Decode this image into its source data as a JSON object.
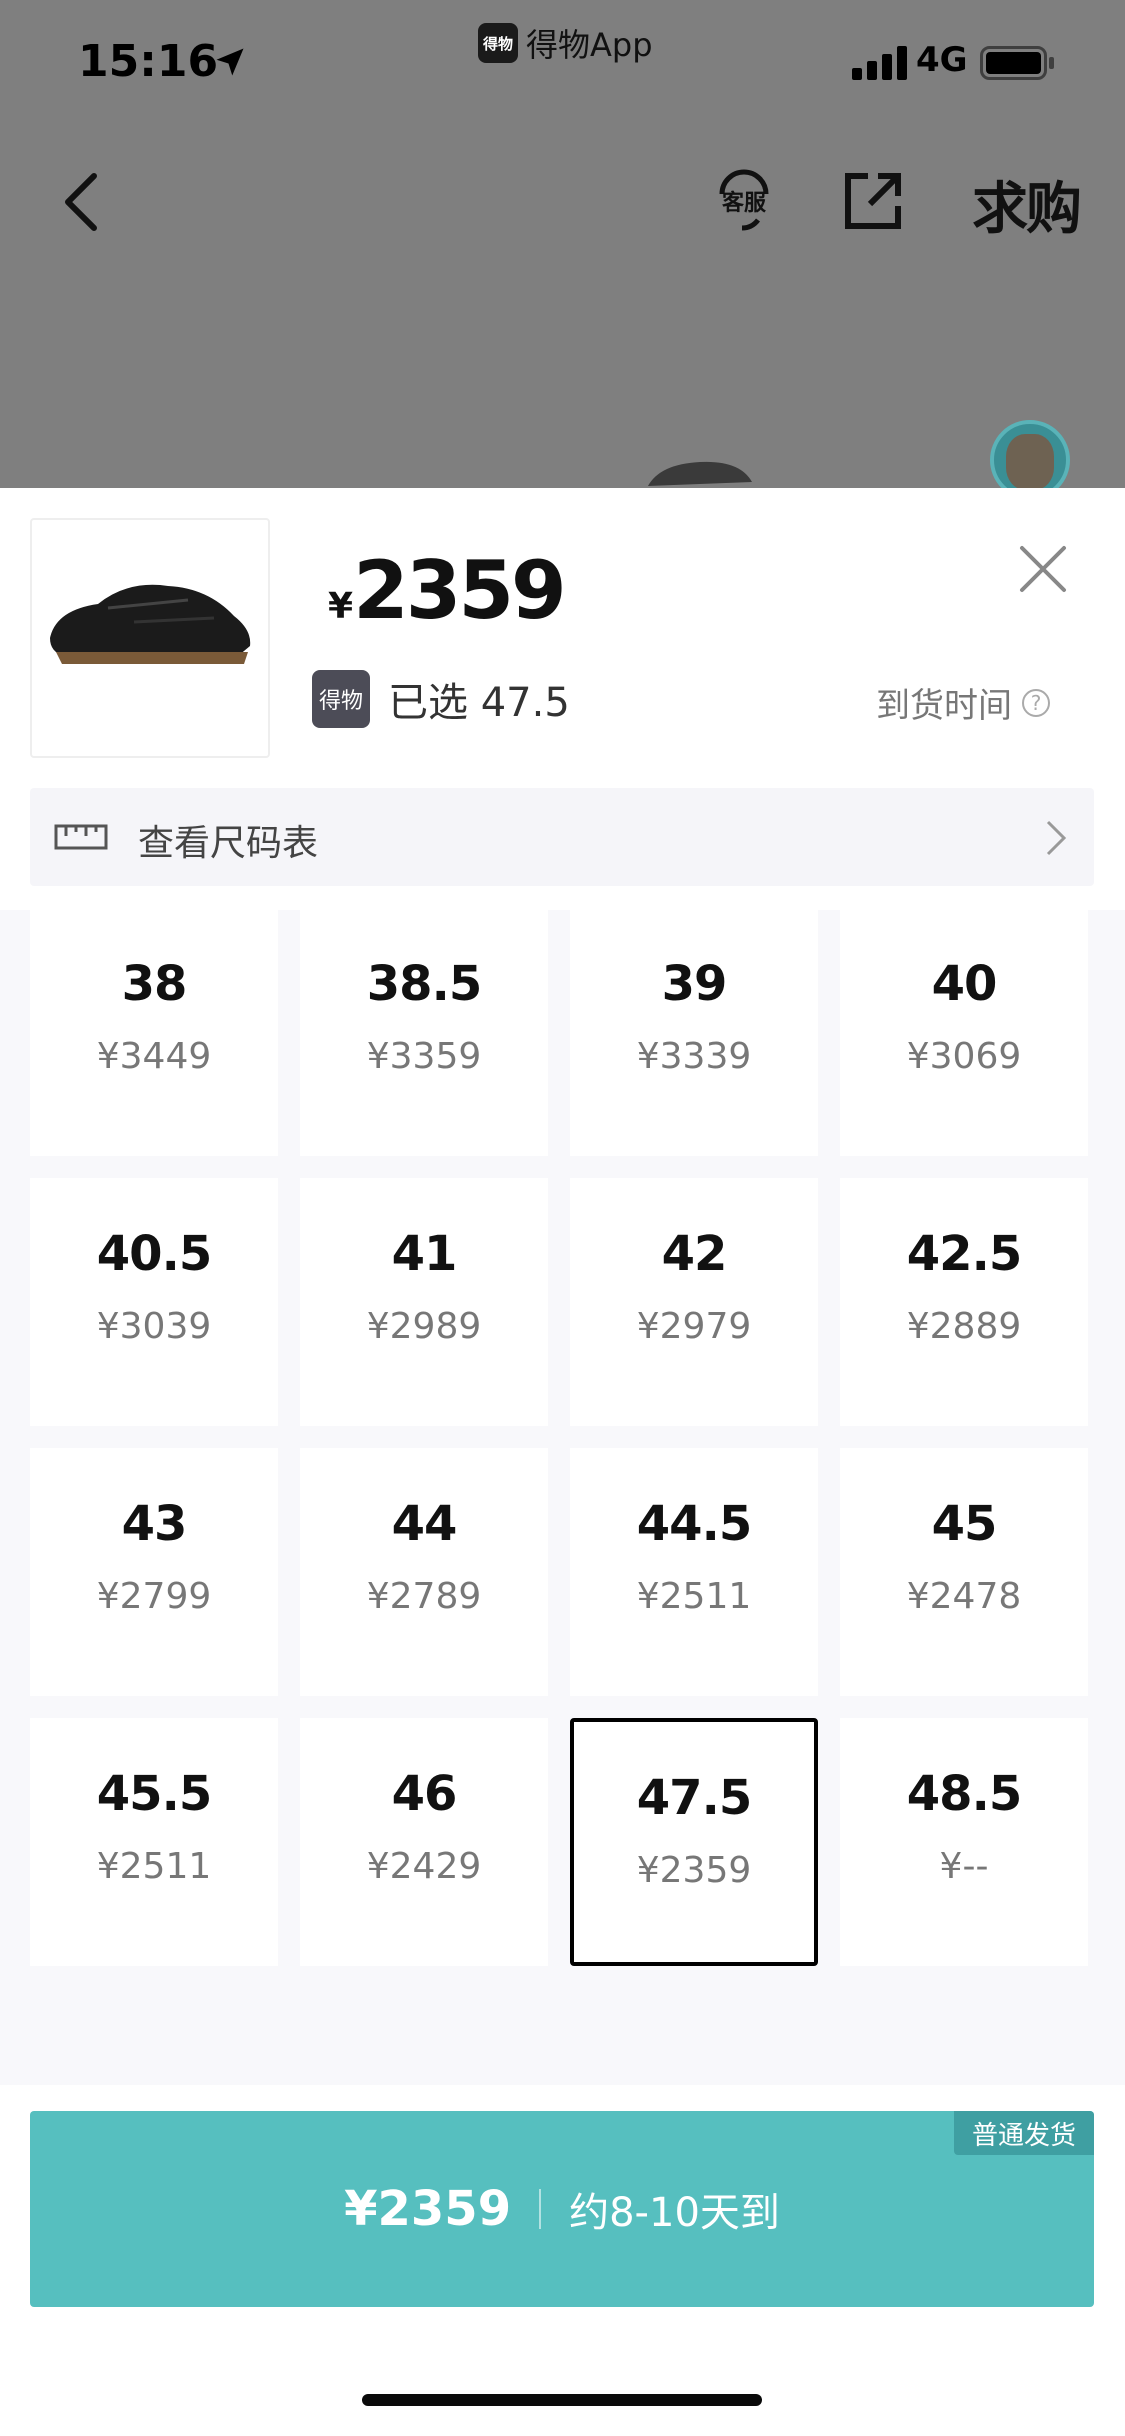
{
  "status_bar": {
    "time": "15:16",
    "back_app": "得物App",
    "app_logo_text": "得物",
    "network": "4G"
  },
  "nav": {
    "service_label": "客服",
    "want_label": "求购"
  },
  "product": {
    "currency": "¥",
    "price": "2359",
    "selected_logo": "得物",
    "selected_text": "已选 47.5",
    "arrival_label": "到货时间",
    "help_glyph": "?"
  },
  "size_chart": {
    "label": "查看尺码表"
  },
  "sizes": [
    {
      "size": "38",
      "price": "¥3449"
    },
    {
      "size": "38.5",
      "price": "¥3359"
    },
    {
      "size": "39",
      "price": "¥3339"
    },
    {
      "size": "40",
      "price": "¥3069"
    },
    {
      "size": "40.5",
      "price": "¥3039"
    },
    {
      "size": "41",
      "price": "¥2989"
    },
    {
      "size": "42",
      "price": "¥2979"
    },
    {
      "size": "42.5",
      "price": "¥2889"
    },
    {
      "size": "43",
      "price": "¥2799"
    },
    {
      "size": "44",
      "price": "¥2789"
    },
    {
      "size": "44.5",
      "price": "¥2511"
    },
    {
      "size": "45",
      "price": "¥2478"
    },
    {
      "size": "45.5",
      "price": "¥2511"
    },
    {
      "size": "46",
      "price": "¥2429"
    },
    {
      "size": "47.5",
      "price": "¥2359",
      "selected": true
    },
    {
      "size": "48.5",
      "price": "¥--"
    }
  ],
  "buy_button": {
    "tag": "普通发货",
    "price": "¥2359",
    "eta": "约8-10天到"
  },
  "colors": {
    "accent": "#56bfbf",
    "accent_dark": "#3f9fa2",
    "overlay": "#7f7f7f"
  }
}
